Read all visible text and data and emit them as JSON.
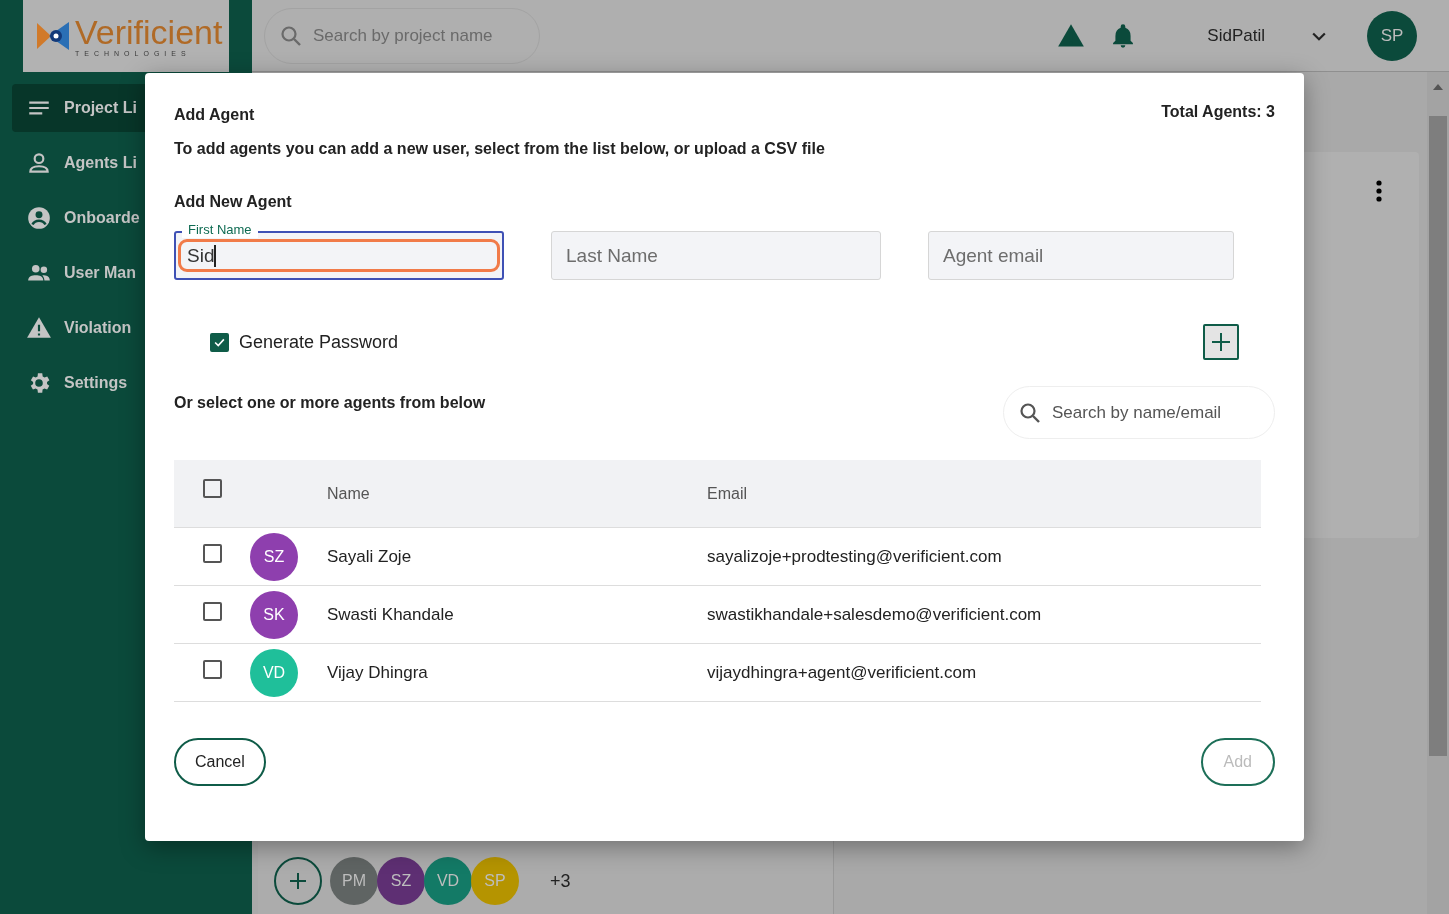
{
  "logo": {
    "name": "Verificient",
    "tagline": "TECHNOLOGIES"
  },
  "header": {
    "search_placeholder": "Search by project name",
    "username": "SidPatil",
    "avatar": "SP"
  },
  "sidebar": {
    "items": [
      {
        "label": "Project Li",
        "selected": true
      },
      {
        "label": "Agents Li",
        "selected": false
      },
      {
        "label": "Onboarde",
        "selected": false
      },
      {
        "label": "User Man",
        "selected": false
      },
      {
        "label": "Violation",
        "selected": false
      },
      {
        "label": "Settings",
        "selected": false
      }
    ]
  },
  "background": {
    "avatars": [
      {
        "initials": "PM",
        "color": "#5f6463"
      },
      {
        "initials": "SZ",
        "color": "#5e2f73"
      },
      {
        "initials": "VD",
        "color": "#137a66"
      },
      {
        "initials": "SP",
        "color": "#b59400"
      }
    ],
    "more": "+3"
  },
  "dialog": {
    "title": "Add Agent",
    "total": "Total Agents: 3",
    "description": "To add agents you can add a new user, select from the list below, or upload a CSV file",
    "section": "Add New Agent",
    "fields": [
      {
        "label": "First Name",
        "value": "Sid",
        "focused": true
      },
      {
        "placeholder": "Last Name",
        "focused": false
      },
      {
        "placeholder": "Agent email",
        "focused": false
      }
    ],
    "generate_password": {
      "label": "Generate Password",
      "checked": true
    },
    "select_label": "Or select one or more agents from below",
    "search_placeholder": "Search by name/email",
    "table": {
      "columns": [
        "Name",
        "Email"
      ],
      "all_checked": false,
      "rows": [
        {
          "initials": "SZ",
          "color": "#8e3fae",
          "name": "Sayali Zoje",
          "email": "sayalizoje+prodtesting@verificient.com",
          "checked": false
        },
        {
          "initials": "SK",
          "color": "#8e3fae",
          "name": "Swasti Khandale",
          "email": "swastikhandale+salesdemo@verificient.com",
          "checked": false
        },
        {
          "initials": "VD",
          "color": "#1fbf9a",
          "name": "Vijay Dhingra",
          "email": "vijaydhingra+agent@verificient.com",
          "checked": false
        }
      ]
    },
    "buttons": [
      {
        "label": "Cancel",
        "disabled": false
      },
      {
        "label": "Add",
        "disabled": true
      }
    ]
  }
}
